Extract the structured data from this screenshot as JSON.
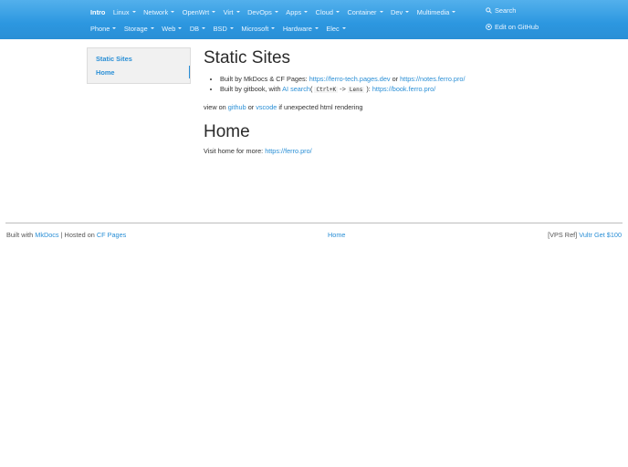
{
  "nav": {
    "row1": [
      {
        "label": "Intro",
        "active": true,
        "caret": false
      },
      {
        "label": "Linux",
        "caret": true
      },
      {
        "label": "Network",
        "caret": true
      },
      {
        "label": "OpenWrt",
        "caret": true
      },
      {
        "label": "Virt",
        "caret": true
      },
      {
        "label": "DevOps",
        "caret": true
      },
      {
        "label": "Apps",
        "caret": true
      },
      {
        "label": "Cloud",
        "caret": true
      },
      {
        "label": "Container",
        "caret": true
      },
      {
        "label": "Dev",
        "caret": true
      },
      {
        "label": "Multimedia",
        "caret": true
      }
    ],
    "row2": [
      {
        "label": "Phone",
        "caret": true
      },
      {
        "label": "Storage",
        "caret": true
      },
      {
        "label": "Web",
        "caret": true
      },
      {
        "label": "DB",
        "caret": true
      },
      {
        "label": "BSD",
        "caret": true
      },
      {
        "label": "Microsoft",
        "caret": true
      },
      {
        "label": "Hardware",
        "caret": true
      },
      {
        "label": "Elec",
        "caret": true
      }
    ],
    "search_label": "Search",
    "search_icon": "search-icon",
    "github_label": "Edit on GitHub",
    "github_icon": "github-icon"
  },
  "toc": {
    "items": [
      "Static Sites",
      "Home"
    ]
  },
  "content": {
    "h1_static": "Static Sites",
    "b1_text": "Built by MkDocs & CF Pages: ",
    "b1_link1": "https://ferro-tech.pages.dev",
    "b1_or": " or ",
    "b1_link2": "https://notes.ferro.pro/",
    "b2_text": "Built by gitbook, with ",
    "b2_link": "AI search",
    "b2_paren_open": "( ",
    "b2_code1": "Ctrl+K",
    "b2_arrow": " -> ",
    "b2_code2": "Lens",
    "b2_paren_close": " ): ",
    "b2_link2": "https://book.ferro.pro/",
    "p1_text1": "view on ",
    "p1_link1": "github",
    "p1_or": " or ",
    "p1_link2": "vscode",
    "p1_text2": " if unexpected html rendering",
    "h1_home": "Home",
    "p2_text": "Visit home for more: ",
    "p2_link": "https://ferro.pro/"
  },
  "footer": {
    "left_text1": "Built with ",
    "left_link1": "MkDocs",
    "left_text2": " | Hosted on ",
    "left_link2": "CF Pages",
    "mid_link": "Home",
    "right_text": "[VPS Ref] ",
    "right_link": "Vultr Get $100"
  },
  "colors": {
    "navbar": "#2c97e0",
    "link": "#2a8fd6"
  }
}
